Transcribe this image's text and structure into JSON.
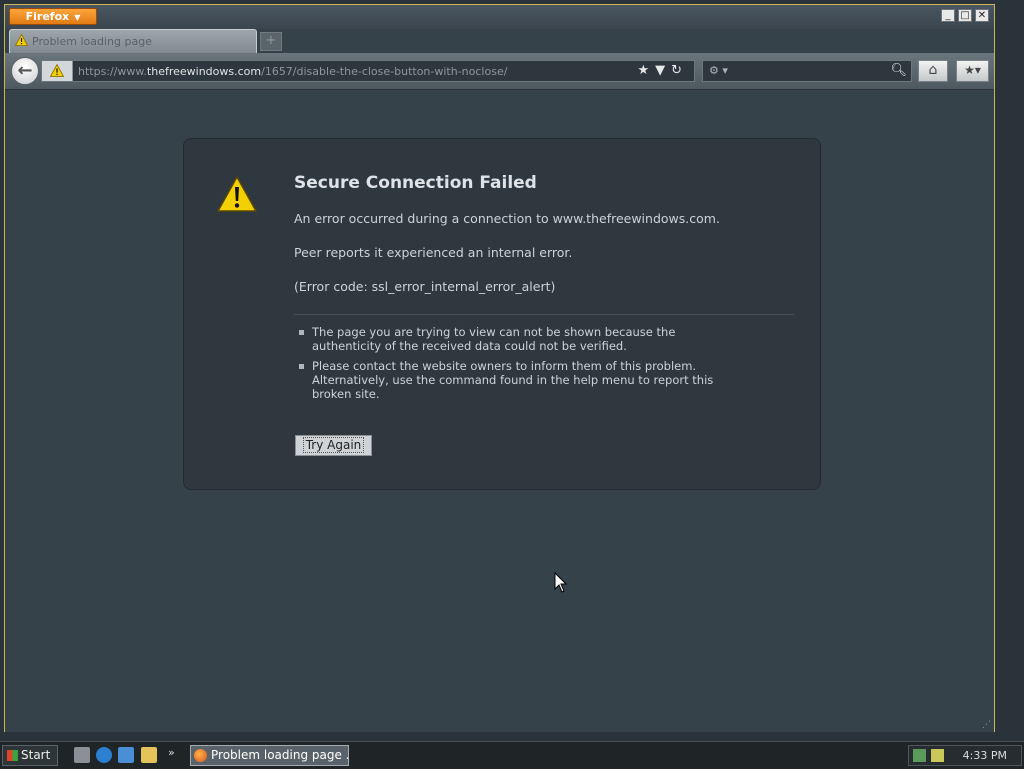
{
  "browser": {
    "menu_button_label": "Firefox",
    "window_controls": {
      "minimize": "_",
      "maximize": "□",
      "close": "✕"
    },
    "tab": {
      "title": "Problem loading page"
    },
    "url": {
      "prefix": "https://www.",
      "host": "thefreewindows.com",
      "path": "/1657/disable-the-close-button-with-noclose/"
    }
  },
  "error": {
    "title": "Secure Connection Failed",
    "line1": "An error occurred during a connection to www.thefreewindows.com.",
    "line2": "Peer reports it experienced an internal error.",
    "line3": "(Error code: ssl_error_internal_error_alert)",
    "bullets": [
      "The page you are trying to view can not be shown because the authenticity of the received data could not be verified.",
      "Please contact the website owners to inform them of this problem. Alternatively, use the command found in the help menu to report this broken site."
    ],
    "try_again_label": "Try Again"
  },
  "taskbar": {
    "start_label": "Start",
    "task_label": "Problem loading page ...",
    "clock": "4:33 PM"
  },
  "colors": {
    "accent": "#e07a14",
    "warning": "#f5d000",
    "window_border": "#c9b65a"
  }
}
